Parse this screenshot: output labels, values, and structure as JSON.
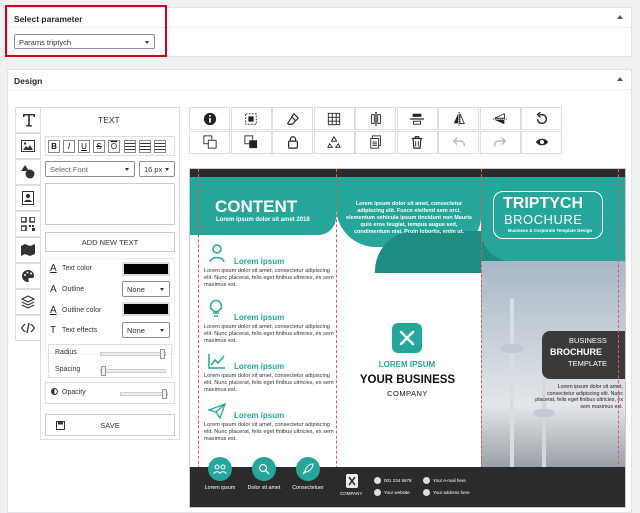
{
  "select_param": {
    "title": "Select parameter",
    "value": "Params triptych"
  },
  "design": {
    "title": "Design"
  },
  "sidebar_icons": [
    "text-icon",
    "image-icon",
    "shapes-icon",
    "contact-icon",
    "qr-code-icon",
    "map-icon",
    "paint-icon",
    "layers-icon",
    "code-icon"
  ],
  "text_panel": {
    "heading": "TEXT",
    "format_buttons": [
      "B",
      "I",
      "U",
      "S",
      "O"
    ],
    "font_select": "Select Font",
    "size_select": "16 px",
    "add_button": "ADD NEW TEXT",
    "text_color_label": "Text color",
    "outline_label": "Outline",
    "outline_value": "None",
    "outline_color_label": "Outline color",
    "text_effects_label": "Text effects",
    "effects_value": "None",
    "radius_label": "Radius",
    "spacing_label": "Spacing",
    "opacity_label": "Opacity",
    "save_button": "SAVE"
  },
  "toolbar_icons": [
    "info-icon",
    "select-icon",
    "eraser-icon",
    "grid-icon",
    "align-vertical-icon",
    "align-horizontal-icon",
    "flip-horizontal-icon",
    "flip-vertical-icon",
    "reset-icon",
    "send-back-icon",
    "bring-front-icon",
    "lock-icon",
    "recycle-icon",
    "duplicate-icon",
    "trash-icon",
    "undo-icon",
    "redo-icon",
    "preview-icon"
  ],
  "brochure": {
    "content_title": "CONTENT",
    "content_sub": "Lorem ipsum dolor sit amet 2018",
    "mid_text": "Lorem ipsum dolor sit amet, consectetur adipiscing elit. Fusce eleifend sem orci, elementum vehicula ipsum tincidunt non Mauris quis eros feugiat, tempus augue sed, condimentum nisi. Proin lobortis, enim ut.",
    "triptych": "TRIPTYCH",
    "brochure_word": "BROCHURE",
    "tagline": "Business & Corporate Template Design",
    "features": [
      {
        "title": "Lorem ipsum",
        "text": "Lorem ipsum dolor sit amet, consectetur adipiscing elit. Nunc placerat, felis eget finibus ultricies, ex sem maximus est."
      },
      {
        "title": "Lorem ipsum",
        "text": "Lorem ipsum dolor sit amet, consectetur adipiscing elit. Nunc placerat, felis eget finibus ultricies, ex sem maximus est."
      },
      {
        "title": "Lorem ipsum",
        "text": "Lorem ipsum dolor sit amet, consectetur adipiscing elit. Nunc placerat, felis eget finibus ultricies, ex sem maximus est."
      },
      {
        "title": "Lorem ipsum",
        "text": "Lorem ipsum dolor sit amet, consectetur adipiscing elit. Nunc placerat, felis eget finibus ultricies, ex sem maximus est."
      }
    ],
    "circle_labels": [
      "Lorem ipsum",
      "Dolor sit amet",
      "Consectetuer"
    ],
    "logo_text": "LOREM IPSUM",
    "your_business": "YOUR BUSINESS",
    "company": "COMPANY",
    "footer_company": "COMPANY",
    "phone": "001 234 5678",
    "website": "Your website",
    "email": "Your e-mail here",
    "address": "Your address here",
    "biz1": "BUSINESS",
    "biz2": "BROCHURE",
    "biz3": "TEMPLATE",
    "right_text": "Lorem ipsum dolor sit amet, consectetur adipiscing elit. Nunc placerat, felis eget finibus ultricies, ex sem maximus est.",
    "colors": {
      "teal": "#26a69a",
      "dark": "#2b2b2b"
    }
  }
}
